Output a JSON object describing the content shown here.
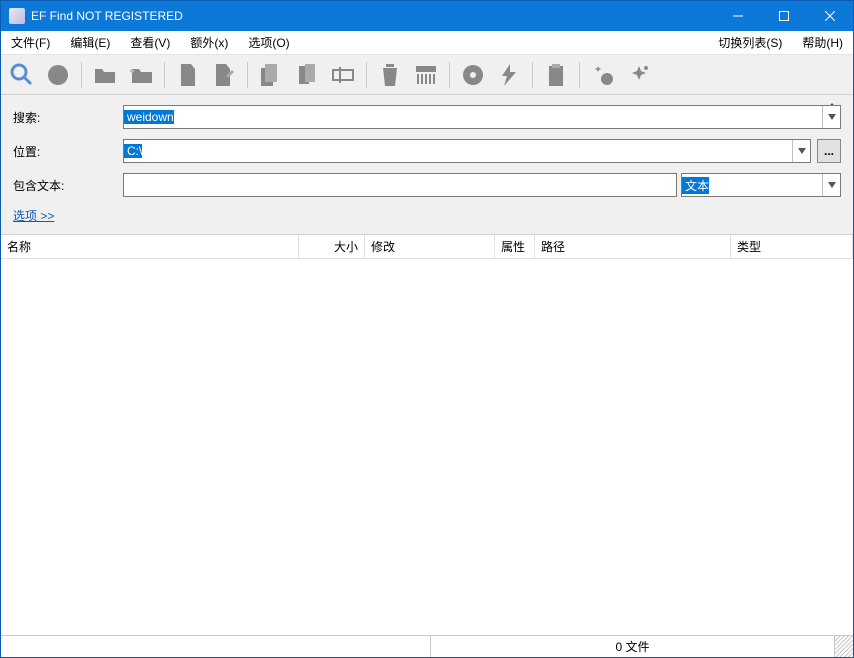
{
  "title": "EF Find NOT REGISTERED",
  "menus": {
    "file": "文件(F)",
    "edit": "编辑(E)",
    "view": "查看(V)",
    "extra": "额外(x)",
    "options": "选项(O)",
    "switch": "切换列表(S)",
    "help": "帮助(H)"
  },
  "labels": {
    "search": "搜索:",
    "location": "位置:",
    "contain": "包含文本:",
    "more": "选项  >>"
  },
  "values": {
    "search": "weidown",
    "location": "C:\\",
    "contain": "",
    "type": "文本"
  },
  "browse_btn": "...",
  "columns": {
    "name": "名称",
    "size": "大小",
    "mod": "修改",
    "attr": "属性",
    "path": "路径",
    "type": "类型"
  },
  "status": {
    "files": "0 文件"
  }
}
